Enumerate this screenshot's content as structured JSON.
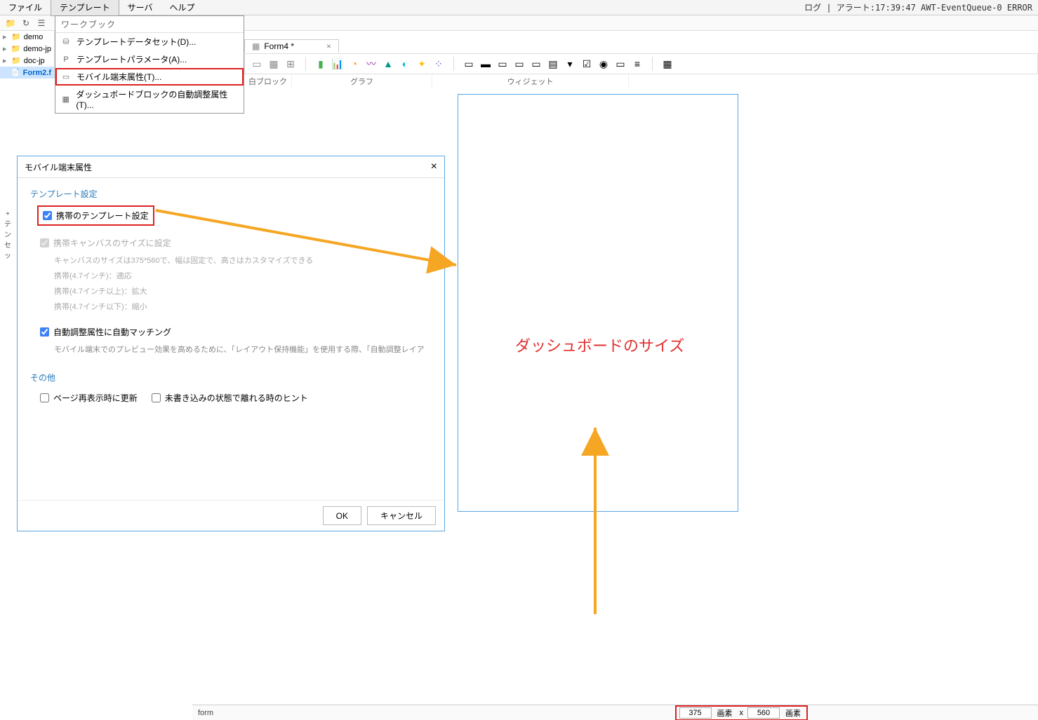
{
  "menu": {
    "file": "ファイル",
    "template": "テンプレート",
    "server": "サーバ",
    "help": "ヘルプ"
  },
  "status_text": "ログ | アラート:17:39:47 AWT-EventQueue-0 ERROR",
  "dropdown": {
    "title": "ワークブック",
    "items": [
      {
        "label": "テンプレートデータセット(D)..."
      },
      {
        "label": "テンプレートパラメータ(A)..."
      },
      {
        "label": "モバイル端末属性(T)..."
      },
      {
        "label": "ダッシュボードブロックの自動調整属性(T)..."
      }
    ]
  },
  "tree": {
    "items": [
      {
        "label": "demo"
      },
      {
        "label": "demo-jp"
      },
      {
        "label": "doc-jp"
      },
      {
        "label": "Form2.f"
      }
    ]
  },
  "tab": {
    "label": "Form4 *"
  },
  "widget_groups": {
    "block": "白ブロック",
    "chart": "グラフ",
    "widget": "ウィジェット"
  },
  "dialog": {
    "title": "モバイル端末属性",
    "section1": "テンプレート設定",
    "chk_mobile_template": "携帯のテンプレート設定",
    "chk_canvas_size": "携帯キャンバスのサイズに設定",
    "canvas_desc": "キャンバスのサイズは375*560で、幅は固定で、高さはカスタマイズできる",
    "size_47": "携帯(4.7インチ)：適応",
    "size_47_up": "携帯(4.7インチ以上)：拡大",
    "size_47_down": "携帯(4.7インチ以下)：縮小",
    "chk_auto_match": "自動調整属性に自動マッチング",
    "auto_match_desc": "モバイル端末でのプレビュー効果を高めるために、「レイアウト保持機能」を使用する際、「自動調整レイア",
    "section2": "その他",
    "chk_refresh": "ページ再表示時に更新",
    "chk_unsaved": "未書き込みの状態で離れる時のヒント",
    "ok": "OK",
    "cancel": "キャンセル"
  },
  "canvas": {
    "dashboard_label": "ダッシュボードのサイズ"
  },
  "left_strip": {
    "plus": "+",
    "line1": "テン",
    "line2": "セッ"
  },
  "statusbar": {
    "form": "form",
    "width": "375",
    "height": "560",
    "unit": "画素",
    "mult": "x"
  }
}
